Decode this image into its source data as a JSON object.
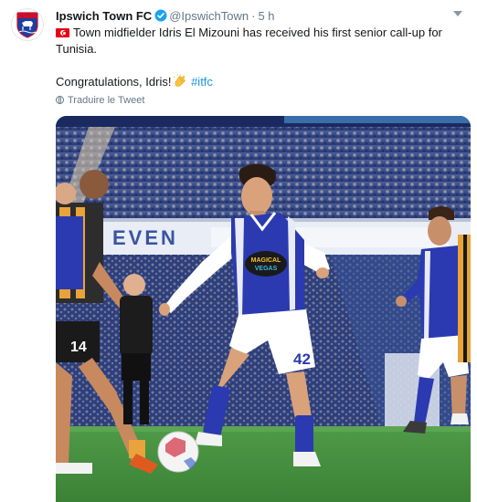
{
  "tweet": {
    "author_name": "Ipswich Town FC",
    "author_handle": "@IpswichTown",
    "separator": "·",
    "time": "5 h",
    "text_line1": "Town midfielder Idris El Mizouni has received his first senior call-up for Tunisia.",
    "text_line2": "Congratulations, Idris!",
    "hashtag": "#itfc",
    "translate": "Traduire le Tweet"
  },
  "photo": {
    "board_text": "EVEN",
    "shirt_sponsor_line1": "MAGICAL",
    "shirt_sponsor_line2": "VEGAS",
    "shirt_number": "42",
    "left_player_number": "14"
  },
  "colors": {
    "accent": "#1b95e0",
    "verified": "#1da1f2",
    "muted": "#657786",
    "ipswich_blue": "#2b3ab0",
    "tunisia_red": "#e70013"
  },
  "icons": [
    "club-crest-icon",
    "verified-badge-icon",
    "tunisia-flag-icon",
    "clapping-hands-icon",
    "globe-icon",
    "chevron-down-icon"
  ]
}
